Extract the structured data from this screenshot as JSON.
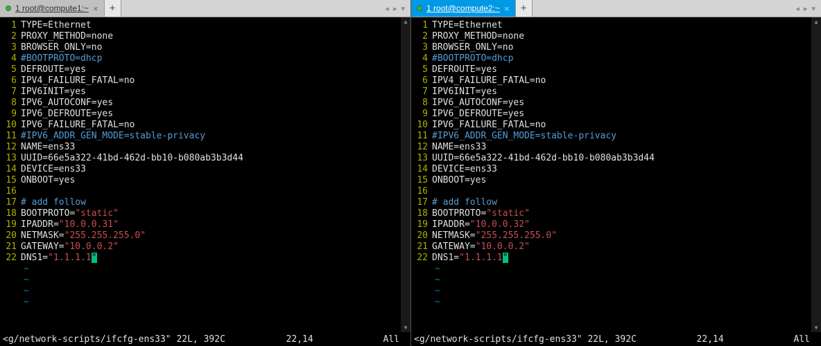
{
  "panes": [
    {
      "tab_number": "1",
      "tab_title": "root@compute1:~",
      "active": false,
      "lines": [
        {
          "n": 1,
          "segs": [
            {
              "t": "TYPE=Ethernet"
            }
          ]
        },
        {
          "n": 2,
          "segs": [
            {
              "t": "PROXY_METHOD=none"
            }
          ]
        },
        {
          "n": 3,
          "segs": [
            {
              "t": "BROWSER_ONLY=no"
            }
          ]
        },
        {
          "n": 4,
          "segs": [
            {
              "t": "#BOOTPROTO=dhcp",
              "cls": "cmt"
            }
          ]
        },
        {
          "n": 5,
          "segs": [
            {
              "t": "DEFROUTE=yes"
            }
          ]
        },
        {
          "n": 6,
          "segs": [
            {
              "t": "IPV4_FAILURE_FATAL=no"
            }
          ]
        },
        {
          "n": 7,
          "segs": [
            {
              "t": "IPV6INIT=yes"
            }
          ]
        },
        {
          "n": 8,
          "segs": [
            {
              "t": "IPV6_AUTOCONF=yes"
            }
          ]
        },
        {
          "n": 9,
          "segs": [
            {
              "t": "IPV6_DEFROUTE=yes"
            }
          ]
        },
        {
          "n": 10,
          "segs": [
            {
              "t": "IPV6_FAILURE_FATAL=no"
            }
          ]
        },
        {
          "n": 11,
          "segs": [
            {
              "t": "#IPV6_ADDR_GEN_MODE=stable-privacy",
              "cls": "cmt"
            }
          ]
        },
        {
          "n": 12,
          "segs": [
            {
              "t": "NAME=ens33"
            }
          ]
        },
        {
          "n": 13,
          "segs": [
            {
              "t": "UUID=66e5a322-41bd-462d-bb10-b080ab3b3d44"
            }
          ]
        },
        {
          "n": 14,
          "segs": [
            {
              "t": "DEVICE=ens33"
            }
          ]
        },
        {
          "n": 15,
          "segs": [
            {
              "t": "ONBOOT=yes"
            }
          ]
        },
        {
          "n": 16,
          "segs": [
            {
              "t": " "
            }
          ]
        },
        {
          "n": 17,
          "segs": [
            {
              "t": "# add follow",
              "cls": "cmt"
            }
          ]
        },
        {
          "n": 18,
          "segs": [
            {
              "t": "BOOTPROTO="
            },
            {
              "t": "\"static\"",
              "cls": "str"
            }
          ]
        },
        {
          "n": 19,
          "segs": [
            {
              "t": "IPADDR="
            },
            {
              "t": "\"10.0.0.31\"",
              "cls": "str"
            }
          ]
        },
        {
          "n": 20,
          "segs": [
            {
              "t": "NETMASK="
            },
            {
              "t": "\"255.255.255.0\"",
              "cls": "str"
            }
          ]
        },
        {
          "n": 21,
          "segs": [
            {
              "t": "GATEWAY="
            },
            {
              "t": "\"10.0.0.2\"",
              "cls": "str"
            }
          ]
        },
        {
          "n": 22,
          "segs": [
            {
              "t": "DNS1="
            },
            {
              "t": "\"1.1.1.1",
              "cls": "str"
            },
            {
              "t": "\"",
              "cls": "cursor"
            }
          ]
        }
      ],
      "tildes": 4,
      "status_file": "<g/network-scripts/ifcfg-ens33\" 22L, 392C",
      "status_pos": "22,14",
      "status_scroll": "All"
    },
    {
      "tab_number": "1",
      "tab_title": "root@compute2:~",
      "active": true,
      "lines": [
        {
          "n": 1,
          "segs": [
            {
              "t": "TYPE=Ethernet"
            }
          ]
        },
        {
          "n": 2,
          "segs": [
            {
              "t": "PROXY_METHOD=none"
            }
          ]
        },
        {
          "n": 3,
          "segs": [
            {
              "t": "BROWSER_ONLY=no"
            }
          ]
        },
        {
          "n": 4,
          "segs": [
            {
              "t": "#BOOTPROTO=dhcp",
              "cls": "cmt"
            }
          ]
        },
        {
          "n": 5,
          "segs": [
            {
              "t": "DEFROUTE=yes"
            }
          ]
        },
        {
          "n": 6,
          "segs": [
            {
              "t": "IPV4_FAILURE_FATAL=no"
            }
          ]
        },
        {
          "n": 7,
          "segs": [
            {
              "t": "IPV6INIT=yes"
            }
          ]
        },
        {
          "n": 8,
          "segs": [
            {
              "t": "IPV6_AUTOCONF=yes"
            }
          ]
        },
        {
          "n": 9,
          "segs": [
            {
              "t": "IPV6_DEFROUTE=yes"
            }
          ]
        },
        {
          "n": 10,
          "segs": [
            {
              "t": "IPV6_FAILURE_FATAL=no"
            }
          ]
        },
        {
          "n": 11,
          "segs": [
            {
              "t": "#IPV6_ADDR_GEN_MODE=stable-privacy",
              "cls": "cmt"
            }
          ]
        },
        {
          "n": 12,
          "segs": [
            {
              "t": "NAME=ens33"
            }
          ]
        },
        {
          "n": 13,
          "segs": [
            {
              "t": "UUID=66e5a322-41bd-462d-bb10-b080ab3b3d44"
            }
          ]
        },
        {
          "n": 14,
          "segs": [
            {
              "t": "DEVICE=ens33"
            }
          ]
        },
        {
          "n": 15,
          "segs": [
            {
              "t": "ONBOOT=yes"
            }
          ]
        },
        {
          "n": 16,
          "segs": [
            {
              "t": " "
            }
          ]
        },
        {
          "n": 17,
          "segs": [
            {
              "t": "# add follow",
              "cls": "cmt"
            }
          ]
        },
        {
          "n": 18,
          "segs": [
            {
              "t": "BOOTPROTO="
            },
            {
              "t": "\"static\"",
              "cls": "str"
            }
          ]
        },
        {
          "n": 19,
          "segs": [
            {
              "t": "IPADDR="
            },
            {
              "t": "\"10.0.0.32\"",
              "cls": "str"
            }
          ]
        },
        {
          "n": 20,
          "segs": [
            {
              "t": "NETMASK="
            },
            {
              "t": "\"255.255.255.0\"",
              "cls": "str"
            }
          ]
        },
        {
          "n": 21,
          "segs": [
            {
              "t": "GATEWAY="
            },
            {
              "t": "\"10.0.0.2\"",
              "cls": "str"
            }
          ]
        },
        {
          "n": 22,
          "segs": [
            {
              "t": "DNS1="
            },
            {
              "t": "\"1.1.1.1",
              "cls": "str"
            },
            {
              "t": "\"",
              "cls": "cursor"
            }
          ]
        }
      ],
      "tildes": 4,
      "status_file": "<g/network-scripts/ifcfg-ens33\" 22L, 392C",
      "status_pos": "22,14",
      "status_scroll": "All"
    }
  ],
  "newtab_label": "+",
  "nav_prev": "◂",
  "nav_next": "▸",
  "nav_menu": "▾"
}
